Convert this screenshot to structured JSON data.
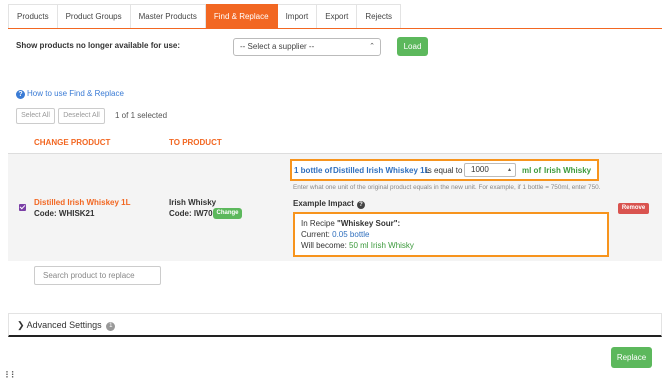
{
  "tabs": [
    "Products",
    "Product Groups",
    "Master Products",
    "Find & Replace",
    "Import",
    "Export",
    "Rejects"
  ],
  "supplier": {
    "label": "Show products no longer available for use:",
    "select_value": "-- Select a supplier --",
    "load_label": "Load"
  },
  "howto_label": "How to use Find & Replace",
  "selection": {
    "select_all": "Select All",
    "deselect_all": "Deselect All",
    "count": "1 of 1 selected"
  },
  "columns": {
    "change": "CHANGE PRODUCT",
    "to": "TO PRODUCT"
  },
  "row": {
    "from_name": "Distilled Irish Whiskey 1L",
    "from_code": "Code: WHISK21",
    "to_name": "Irish Whisky",
    "to_code": "Code: IW70",
    "change_label": "Change",
    "equal": {
      "from_unit": "1 bottle of",
      "from_product": "Distilled Irish Whiskey 1L",
      "is_equal_to": "is equal to",
      "quantity": "1000",
      "to_unit": "ml of",
      "to_product": "Irish Whisky"
    },
    "hint": "Enter what one unit of the original product equals in the new unit. For example, if 1 bottle = 750ml, enter 750.",
    "example_title": "Example Impact",
    "impact": {
      "recipe_prefix": "In Recipe ",
      "recipe_name": "\"Whiskey Sour\":",
      "current_label": "Current: ",
      "current_value": "0.05 bottle",
      "will_become_label": "Will become: ",
      "will_become_value": "50 ml Irish Whisky"
    },
    "remove_label": "Remove"
  },
  "search_placeholder": "Search product to replace",
  "advanced": {
    "label": "Advanced Settings",
    "badge": "1"
  },
  "replace_label": "Replace",
  "colors": {
    "accent": "#f26722",
    "green": "#5cb85c",
    "highlight": "#f7941d",
    "link": "#2f6fbe",
    "danger": "#d9534f"
  }
}
